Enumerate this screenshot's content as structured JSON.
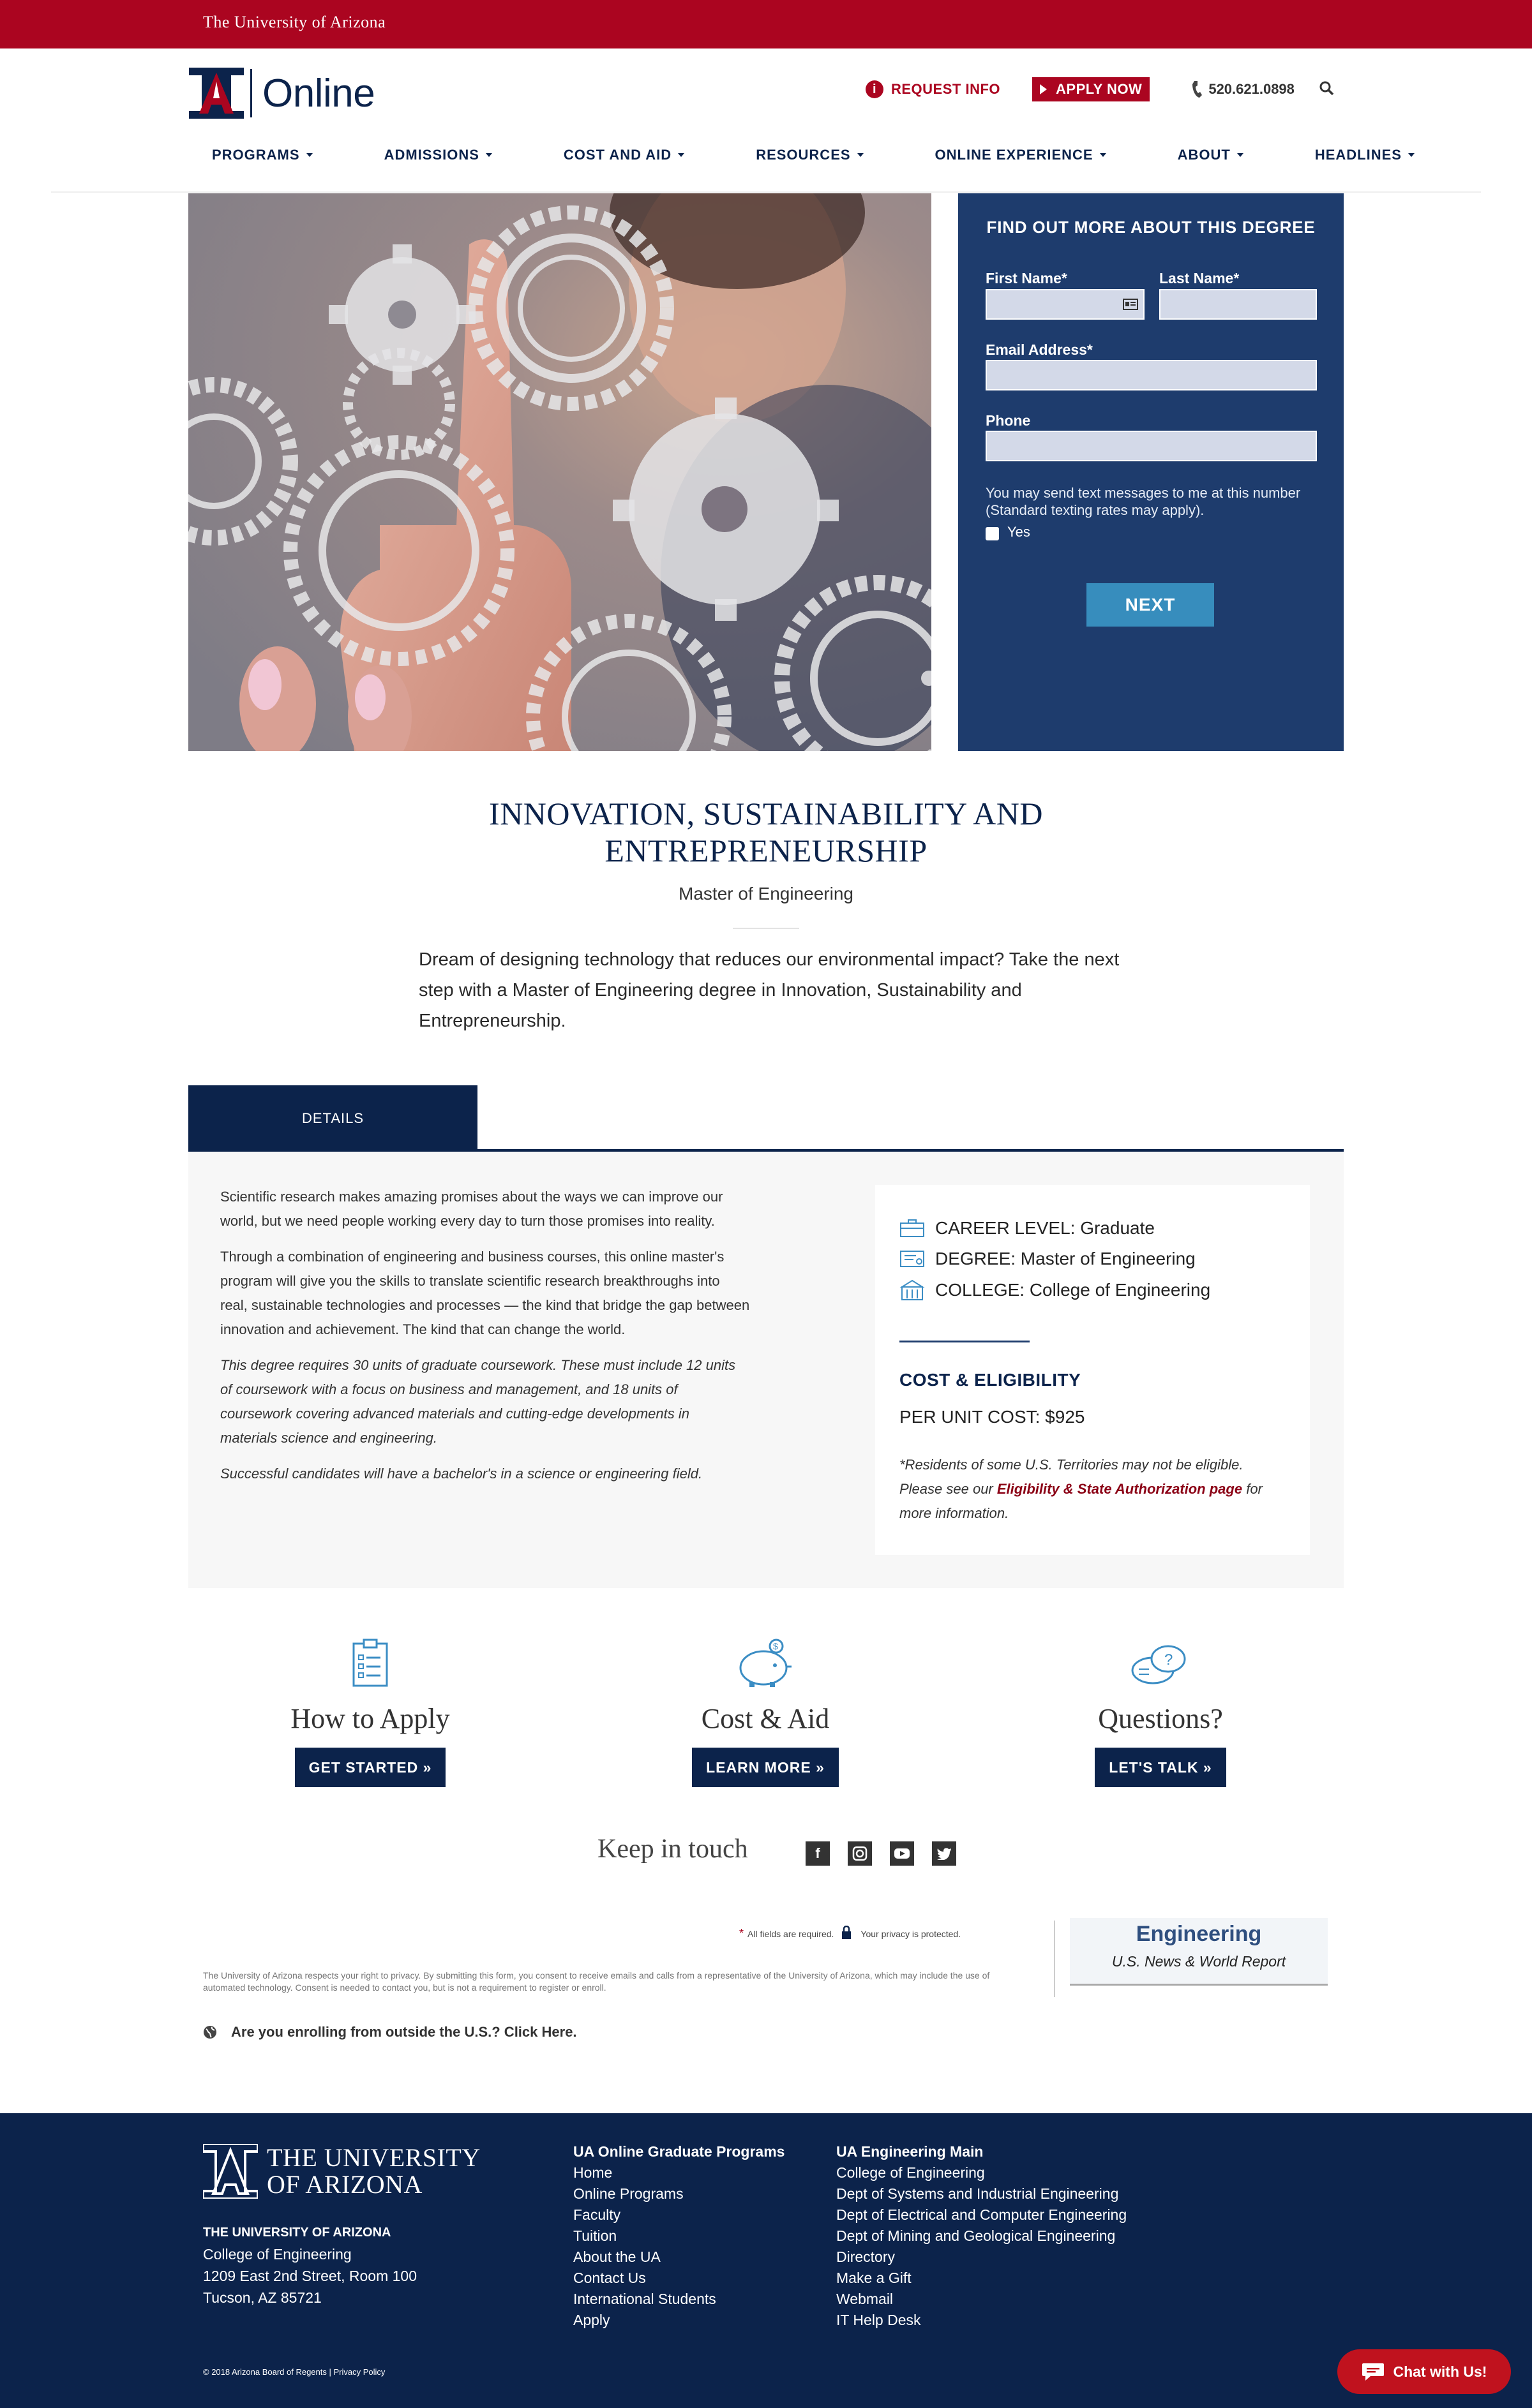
{
  "topbar": {
    "title": "The University of Arizona"
  },
  "header": {
    "logo_text": "Online",
    "request_info": "REQUEST INFO",
    "apply_now": "APPLY NOW",
    "phone": "520.621.0898"
  },
  "nav": {
    "items": [
      {
        "label": "PROGRAMS"
      },
      {
        "label": "ADMISSIONS"
      },
      {
        "label": "COST AND AID"
      },
      {
        "label": "RESOURCES"
      },
      {
        "label": "ONLINE EXPERIENCE"
      },
      {
        "label": "ABOUT"
      },
      {
        "label": "HEADLINES"
      }
    ]
  },
  "form": {
    "title": "FIND OUT MORE ABOUT THIS DEGREE",
    "first_name_label": "First Name*",
    "last_name_label": "Last Name*",
    "email_label": "Email Address*",
    "phone_label": "Phone",
    "sms_text": "You may send text messages to me at this number (Standard texting rates may apply).",
    "yes_label": "Yes",
    "next_button": "NEXT"
  },
  "program": {
    "title_line1": "INNOVATION, SUSTAINABILITY AND",
    "title_line2": "ENTREPRENEURSHIP",
    "subtitle": "Master of Engineering",
    "intro": "Dream of designing technology that reduces our environmental impact? Take the next step with a Master of Engineering degree in Innovation, Sustainability and Entrepreneurship."
  },
  "tabs": {
    "details": "DETAILS"
  },
  "details": {
    "p1": "Scientific research makes amazing promises about the ways we can improve our world, but we need people working every day to turn those promises into reality.",
    "p2": "Through a combination of engineering and business courses, this online master's program will give you the skills to translate scientific research breakthroughs into real, sustainable technologies and processes — the kind that bridge the gap between innovation and achievement. The kind that can change the world.",
    "p3": "This degree requires 30 units of graduate coursework. These must include 12 units of coursework with a focus on business and management, and 18 units of coursework covering advanced materials and cutting-edge developments in materials science and engineering.",
    "p4": "Successful candidates will have a bachelor's in a science or engineering field."
  },
  "card": {
    "career_level": "CAREER LEVEL: Graduate",
    "degree": "DEGREE: Master of Engineering",
    "college": "COLLEGE: College of Engineering",
    "cost_title": "COST & ELIGIBILITY",
    "per_unit": "PER UNIT COST: $925",
    "note_before": "*Residents of some U.S. Territories may not be eligible. Please see our ",
    "note_link": "Eligibility & State Authorization page",
    "note_after": " for more information."
  },
  "cta": [
    {
      "title": "How to Apply",
      "button": "GET STARTED »",
      "icon": "clipboard-icon"
    },
    {
      "title": "Cost & Aid",
      "button": "LEARN MORE »",
      "icon": "piggy-bank-icon"
    },
    {
      "title": "Questions?",
      "button": "LET'S TALK »",
      "icon": "chat-bubbles-icon"
    }
  ],
  "social": {
    "title": "Keep in touch"
  },
  "legal": {
    "required": "All fields are required.",
    "privacy_protected": "Your privacy is protected.",
    "privacy_text": "The University of Arizona respects your right to privacy. By submitting this form, you consent to receive emails and calls from a representative of the University of Arizona, which may include the use of automated technology. Consent is needed to contact you, but is not a requirement to register or enroll.",
    "badge_title": "Engineering",
    "badge_sub": "U.S. News & World Report",
    "outside_us": "Are you enrolling from outside the U.S.? Click Here."
  },
  "footer": {
    "logo_line1": "The University",
    "logo_line2": "of Arizona",
    "addr_title": "THE UNIVERSITY OF ARIZONA",
    "addr_1": "College of Engineering",
    "addr_2": "1209 East 2nd Street, Room 100",
    "addr_3": "Tucson, AZ 85721",
    "col1_title": "UA Online Graduate Programs",
    "col1": [
      "Home",
      "Online Programs",
      "Faculty",
      "Tuition",
      "About the UA",
      "Contact Us",
      "International Students",
      "Apply"
    ],
    "col2_title": "UA Engineering Main",
    "col2": [
      "College of Engineering",
      "Dept of Systems and Industrial Engineering",
      "Dept of Electrical and Computer Engineering",
      "Dept of Mining and Geological Engineering",
      "Directory",
      "Make a Gift",
      "Webmail",
      "IT Help Desk"
    ],
    "copyright": "© 2018 Arizona Board of Regents | Privacy Policy"
  },
  "chat": {
    "label": "Chat with Us!"
  },
  "colors": {
    "red": "#ab0520",
    "navy": "#0c234b",
    "form_blue": "#1e3c6d",
    "button_blue": "#378dbd"
  }
}
